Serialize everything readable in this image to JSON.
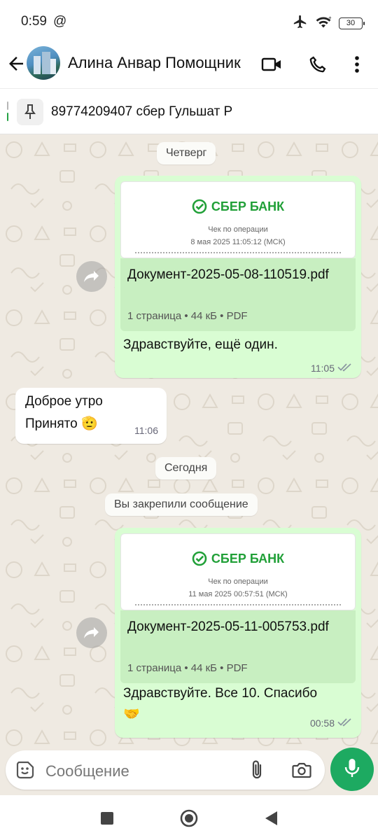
{
  "status_bar": {
    "time": "0:59",
    "at_symbol": "@",
    "battery": "30",
    "icons": [
      "airplane-icon",
      "wifi-icon",
      "battery-icon"
    ]
  },
  "header": {
    "contact_name": "Алина Анвар Помощник",
    "icons": [
      "back-arrow-icon",
      "video-call-icon",
      "phone-icon",
      "more-vert-icon"
    ]
  },
  "pinned": {
    "text": "89774209407 сбер Гульшат Р",
    "icon": "pin-icon"
  },
  "chat": {
    "date_thursday": "Четверг",
    "msg1": {
      "bank_name": "СБЕР БАНК",
      "receipt_title": "Чек по операции",
      "receipt_date": "8 мая 2025 11:05:12 (МСК)",
      "file_name": "Документ-2025-05-08-110519.pdf",
      "file_meta": "1 страница • 44 кБ • PDF",
      "caption": "Здравствуйте, ещё один.",
      "time": "11:05"
    },
    "msg2": {
      "line1": "Доброе утро",
      "line2": "Принято",
      "emoji": "🫡",
      "time": "11:06"
    },
    "date_today": "Сегодня",
    "system_pinned": "Вы закрепили сообщение",
    "msg3": {
      "bank_name": "СБЕР БАНК",
      "receipt_title": "Чек по операции",
      "receipt_date": "11 мая 2025 00:57:51 (МСК)",
      "file_name": "Документ-2025-05-11-005753.pdf",
      "file_meta": "1 страница • 44 кБ • PDF",
      "caption": "Здравствуйте. Все 10. Спасибо",
      "emoji": "🤝",
      "time": "00:58"
    }
  },
  "composer": {
    "placeholder": "Сообщение",
    "icons": [
      "sticker-icon",
      "attach-icon",
      "camera-icon",
      "mic-icon"
    ]
  },
  "colors": {
    "accent": "#1daa61",
    "bubble_out": "#d9fdd3",
    "doc_panel": "#c8efc1",
    "sber_green": "#21a038",
    "read_ticks": "#8a96a0"
  }
}
